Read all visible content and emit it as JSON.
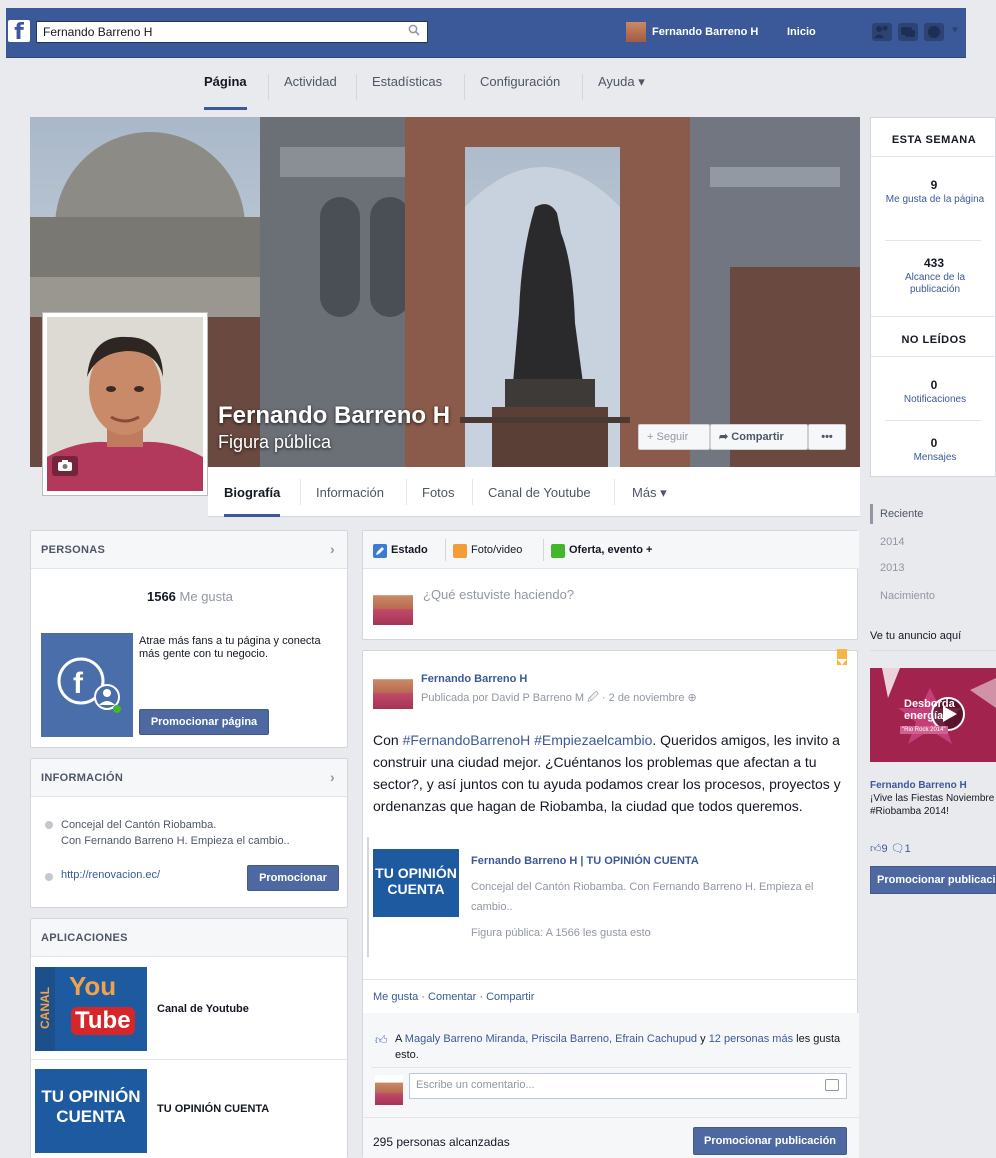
{
  "topbar": {
    "search_value": "Fernando Barreno H",
    "user_name": "Fernando Barreno H",
    "home_label": "Inicio",
    "logo": "f"
  },
  "admin_tabs": [
    "Página",
    "Actividad",
    "Estadísticas",
    "Configuración",
    "Ayuda ▾"
  ],
  "cover": {
    "page_name": "Fernando Barreno H",
    "category": "Figura pública",
    "follow_label": "Seguir",
    "share_label": "Compartir",
    "more_label": "•••"
  },
  "timeline_tabs": [
    "Biografía",
    "Información",
    "Fotos",
    "Canal de Youtube",
    "Más ▾"
  ],
  "this_week": {
    "heading": "ESTA SEMANA",
    "likes_count": "9",
    "likes_label": "Me gusta de la página",
    "reach_count": "433",
    "reach_label": "Alcance de la publicación",
    "unread_heading": "NO LEÍDOS",
    "notif_count": "0",
    "notif_label": "Notificaciones",
    "msg_count": "0",
    "msg_label": "Mensajes"
  },
  "years": [
    "Reciente",
    "2014",
    "2013",
    "Nacimiento"
  ],
  "ad": {
    "title": "Ve tu anuncio aquí",
    "image_text": "Desborda energía",
    "image_badge": "\"Rio Rock 2014\"",
    "name": "Fernando Barreno H",
    "text_line1": "¡Vive las Fiestas Noviembre",
    "text_line2": "#Riobamba 2014!",
    "likes": "9",
    "comments": "1",
    "button": "Promocionar publicación"
  },
  "people": {
    "heading": "PERSONAS",
    "likes_count": "1566",
    "likes_word": "Me gusta",
    "promo_text": "Atrae más fans a tu página y conecta más gente con tu negocio.",
    "promo_button": "Promocionar página"
  },
  "info": {
    "heading": "INFORMACIÓN",
    "desc_line1": "Concejal del Cantón Riobamba.",
    "desc_line2": "Con Fernando Barreno H. Empieza el cambio..",
    "url": "http://renovacion.ec/",
    "promo_button": "Promocionar"
  },
  "apps": {
    "heading": "APLICACIONES",
    "items": [
      {
        "label": "Canal de Youtube",
        "thumb_top": "You",
        "thumb_bottom": "Tube",
        "thumb_side": "CANAL"
      },
      {
        "label": "TU OPINIÓN CUENTA",
        "thumb_top": "TU OPINIÓN",
        "thumb_bottom": "CUENTA"
      }
    ]
  },
  "composer": {
    "tab_status": "Estado",
    "tab_photo": "Foto/video",
    "tab_offer": "Oferta, evento +",
    "placeholder": "¿Qué estuviste haciendo?"
  },
  "post": {
    "author": "Fernando Barreno H",
    "meta": "Publicada por David P Barreno M",
    "meta_date": "· 2 de noviembre",
    "hashtags": "#FernandoBarrenoH #Empiezaelcambio",
    "text_prefix": "Con",
    "text_body": ". Queridos amigos, les invito a construir una ciudad mejor. ¿Cuéntanos los problemas que afectan a tu sector?, y así juntos con tu ayuda podamos crear los procesos, proyectos y ordenanzas que hagan de Riobamba, la ciudad que todos queremos.",
    "share_thumb_top": "TU OPINIÓN",
    "share_thumb_bottom": "CUENTA",
    "share_title": "Fernando Barreno H | TU OPINIÓN CUENTA",
    "share_desc": "Concejal del Cantón Riobamba. Con Fernando Barreno H. Empieza el cambio..",
    "share_meta": "Figura pública: A 1566 les gusta esto",
    "action_like": "Me gusta",
    "action_comment": "Comentar",
    "action_share": "Compartir",
    "likers_prefix": "A",
    "likers": "Magaly Barreno Miranda, Priscila Barreno, Efrain Cachupud",
    "likers_mid": "y",
    "likers_more": "12 personas más",
    "likers_suffix": "les gusta esto.",
    "comment_placeholder": "Escribe un comentario...",
    "reach": "295 personas alcanzadas",
    "promo_button": "Promocionar publicación"
  },
  "colors": {
    "brand_blue": "#3b5998",
    "button_blue": "#4e69a2",
    "page_bg": "#e9eaed",
    "bookmark_orange": "#f7b545"
  }
}
